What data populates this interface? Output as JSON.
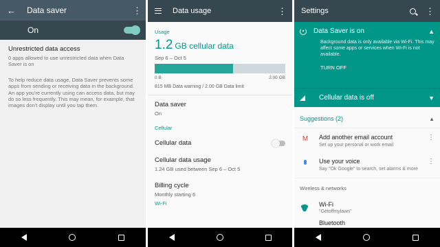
{
  "panel1": {
    "title": "Data saver",
    "switch_label": "On",
    "unrestricted_title": "Unrestricted data access",
    "unrestricted_subtitle": "0 apps allowed to use unrestricted data when Data Saver is on",
    "description": "To help reduce data usage, Data Saver prevents some apps from sending or receiving data in the background. An app you're currently using can access data, but may do so less frequently. This may mean, for example, that images don't display until you tap them.",
    "toggle_on": true
  },
  "panel2": {
    "title": "Data usage",
    "usage_header": "Usage",
    "usage_amount": "1.2",
    "usage_unit": "GB cellular data",
    "usage_range": "Sep 6 – Oct 5",
    "bar_min": "0 B",
    "bar_max": "2.00 GB",
    "bar_fill_fraction": 0.6,
    "warning_text": "815 MB Data warning / 2.00 GB Data limit",
    "data_saver_title": "Data saver",
    "data_saver_value": "On",
    "section_cellular": "Cellular",
    "cellular_data_title": "Cellular data",
    "cellular_data_toggle": false,
    "cellular_usage_title": "Cellular data usage",
    "cellular_usage_value": "1.24 GB used between Sep 6 – Oct 5",
    "billing_title": "Billing cycle",
    "billing_value": "Monthly starting 6",
    "partial_section": "Wi-Fi"
  },
  "panel3": {
    "title": "Settings",
    "saver_card_title": "Data Saver is on",
    "saver_card_body": "Background data is only available via Wi-Fi. This may affect some apps or services when Wi-Fi is not available.",
    "saver_card_action": "TURN OFF",
    "cellular_card_title": "Cellular data is off",
    "suggestions_header": "Suggestions (2)",
    "suggestions": [
      {
        "title": "Add another email account",
        "subtitle": "Set up your personal or work email"
      },
      {
        "title": "Use your voice",
        "subtitle": "Say \"Ok Google\" to search, set alarms & more"
      }
    ],
    "category_header": "Wireless & networks",
    "wifi_title": "Wi-Fi",
    "wifi_subtitle": "\"Getoffmylawn\"",
    "bluetooth_title": "Bluetooth"
  },
  "colors": {
    "teal": "#009688",
    "appbar": "#37474f",
    "appbar_alt": "#455a64"
  }
}
